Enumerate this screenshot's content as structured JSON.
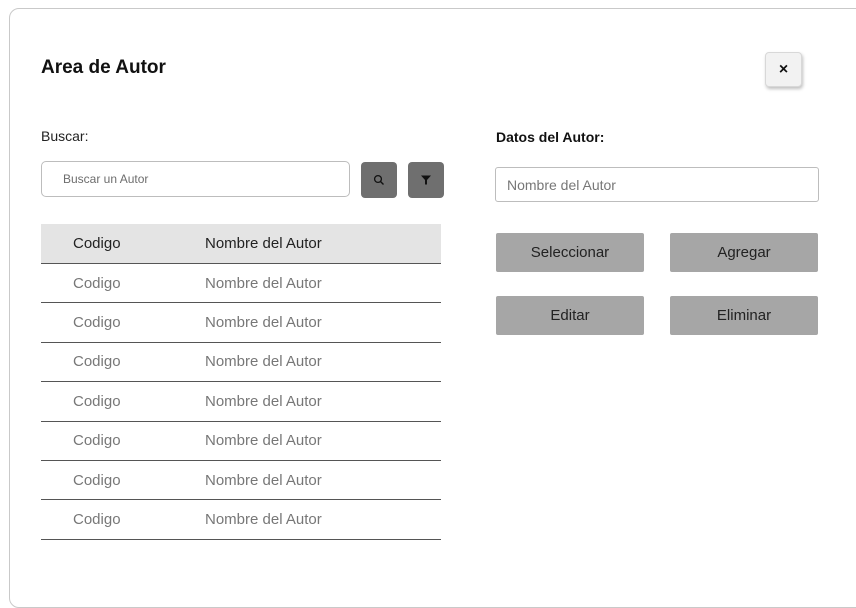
{
  "dialog": {
    "title": "Area de Autor",
    "close_label": "×"
  },
  "search": {
    "label": "Buscar:",
    "placeholder": "Buscar un Autor",
    "search_icon": "search-icon",
    "filter_icon": "filter-icon"
  },
  "table": {
    "headers": [
      "Codigo",
      "Nombre del Autor"
    ],
    "rows": [
      [
        "Codigo",
        "Nombre del Autor"
      ],
      [
        "Codigo",
        "Nombre del Autor"
      ],
      [
        "Codigo",
        "Nombre del Autor"
      ],
      [
        "Codigo",
        "Nombre del Autor"
      ],
      [
        "Codigo",
        "Nombre del Autor"
      ],
      [
        "Codigo",
        "Nombre del Autor"
      ],
      [
        "Codigo",
        "Nombre del Autor"
      ]
    ]
  },
  "details": {
    "label": "Datos del Autor:",
    "name_placeholder": "Nombre del Autor"
  },
  "actions": {
    "select": "Seleccionar",
    "add": "Agregar",
    "edit": "Editar",
    "delete": "Eliminar"
  },
  "colors": {
    "icon_button": "#6f6f6f",
    "action_button": "#a6a6a6",
    "table_header": "#e4e4e4"
  }
}
